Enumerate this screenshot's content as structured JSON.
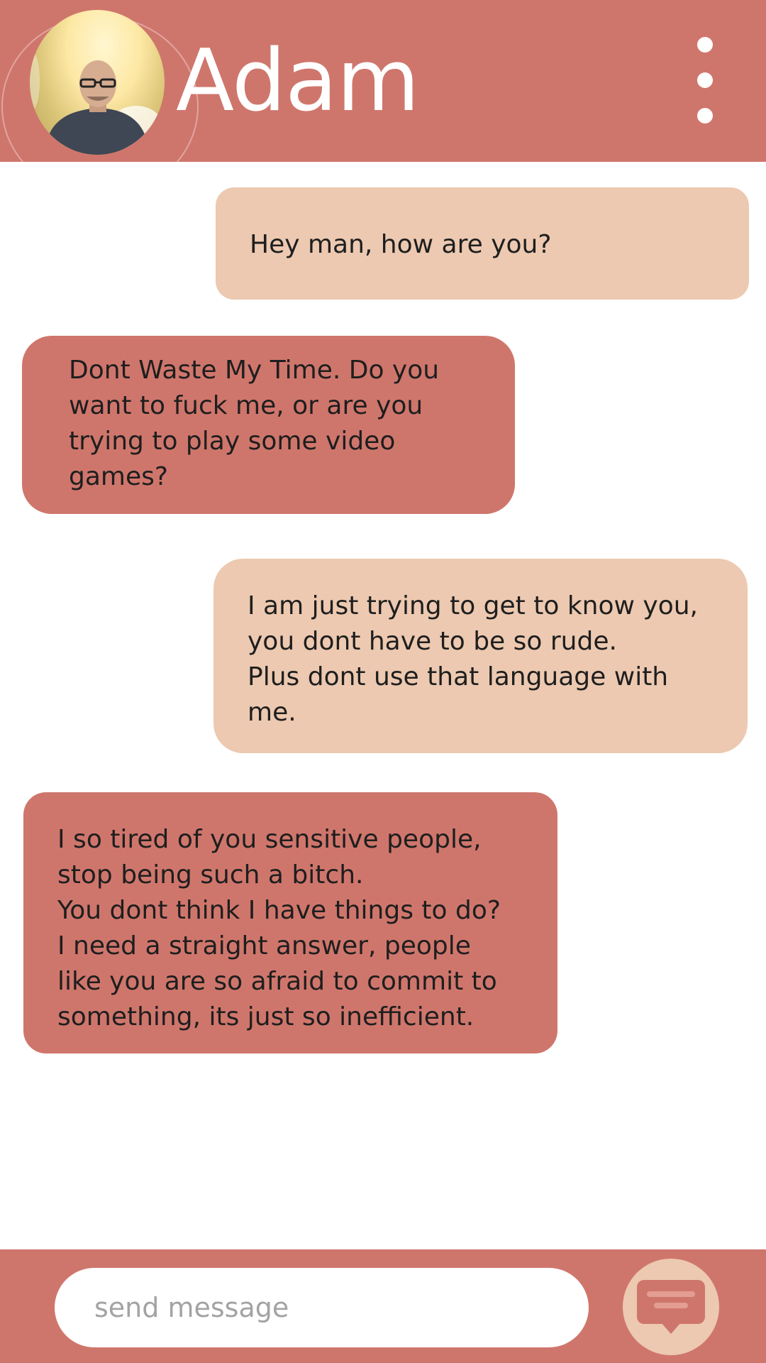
{
  "header": {
    "contact_name": "Adam",
    "avatar_icon": "contact-photo",
    "menu_icon": "vertical-dots-icon"
  },
  "messages": [
    {
      "sender": "me",
      "text": "Hey man, how are you?"
    },
    {
      "sender": "contact",
      "text": "Dont Waste My Time. Do you\nwant to fuck me, or are you\ntrying to play some video\ngames?"
    },
    {
      "sender": "me",
      "text": "I am just trying to get to know you,\nyou dont have to be so rude.\nPlus dont use that language with\nme."
    },
    {
      "sender": "contact",
      "text": "I so tired of you sensitive people,\nstop being such a bitch.\nYou dont think I have things to do?\nI need a straight answer, people\nlike you are so afraid to commit to\nsomething, its just so inefficient."
    }
  ],
  "composer": {
    "placeholder": "send message",
    "value": "",
    "send_icon": "message-bubble-icon"
  },
  "colors": {
    "accent": "#cf766c",
    "sent_bubble": "#ecc9b0",
    "received_bubble": "#cf766c",
    "background": "#ffffff"
  }
}
